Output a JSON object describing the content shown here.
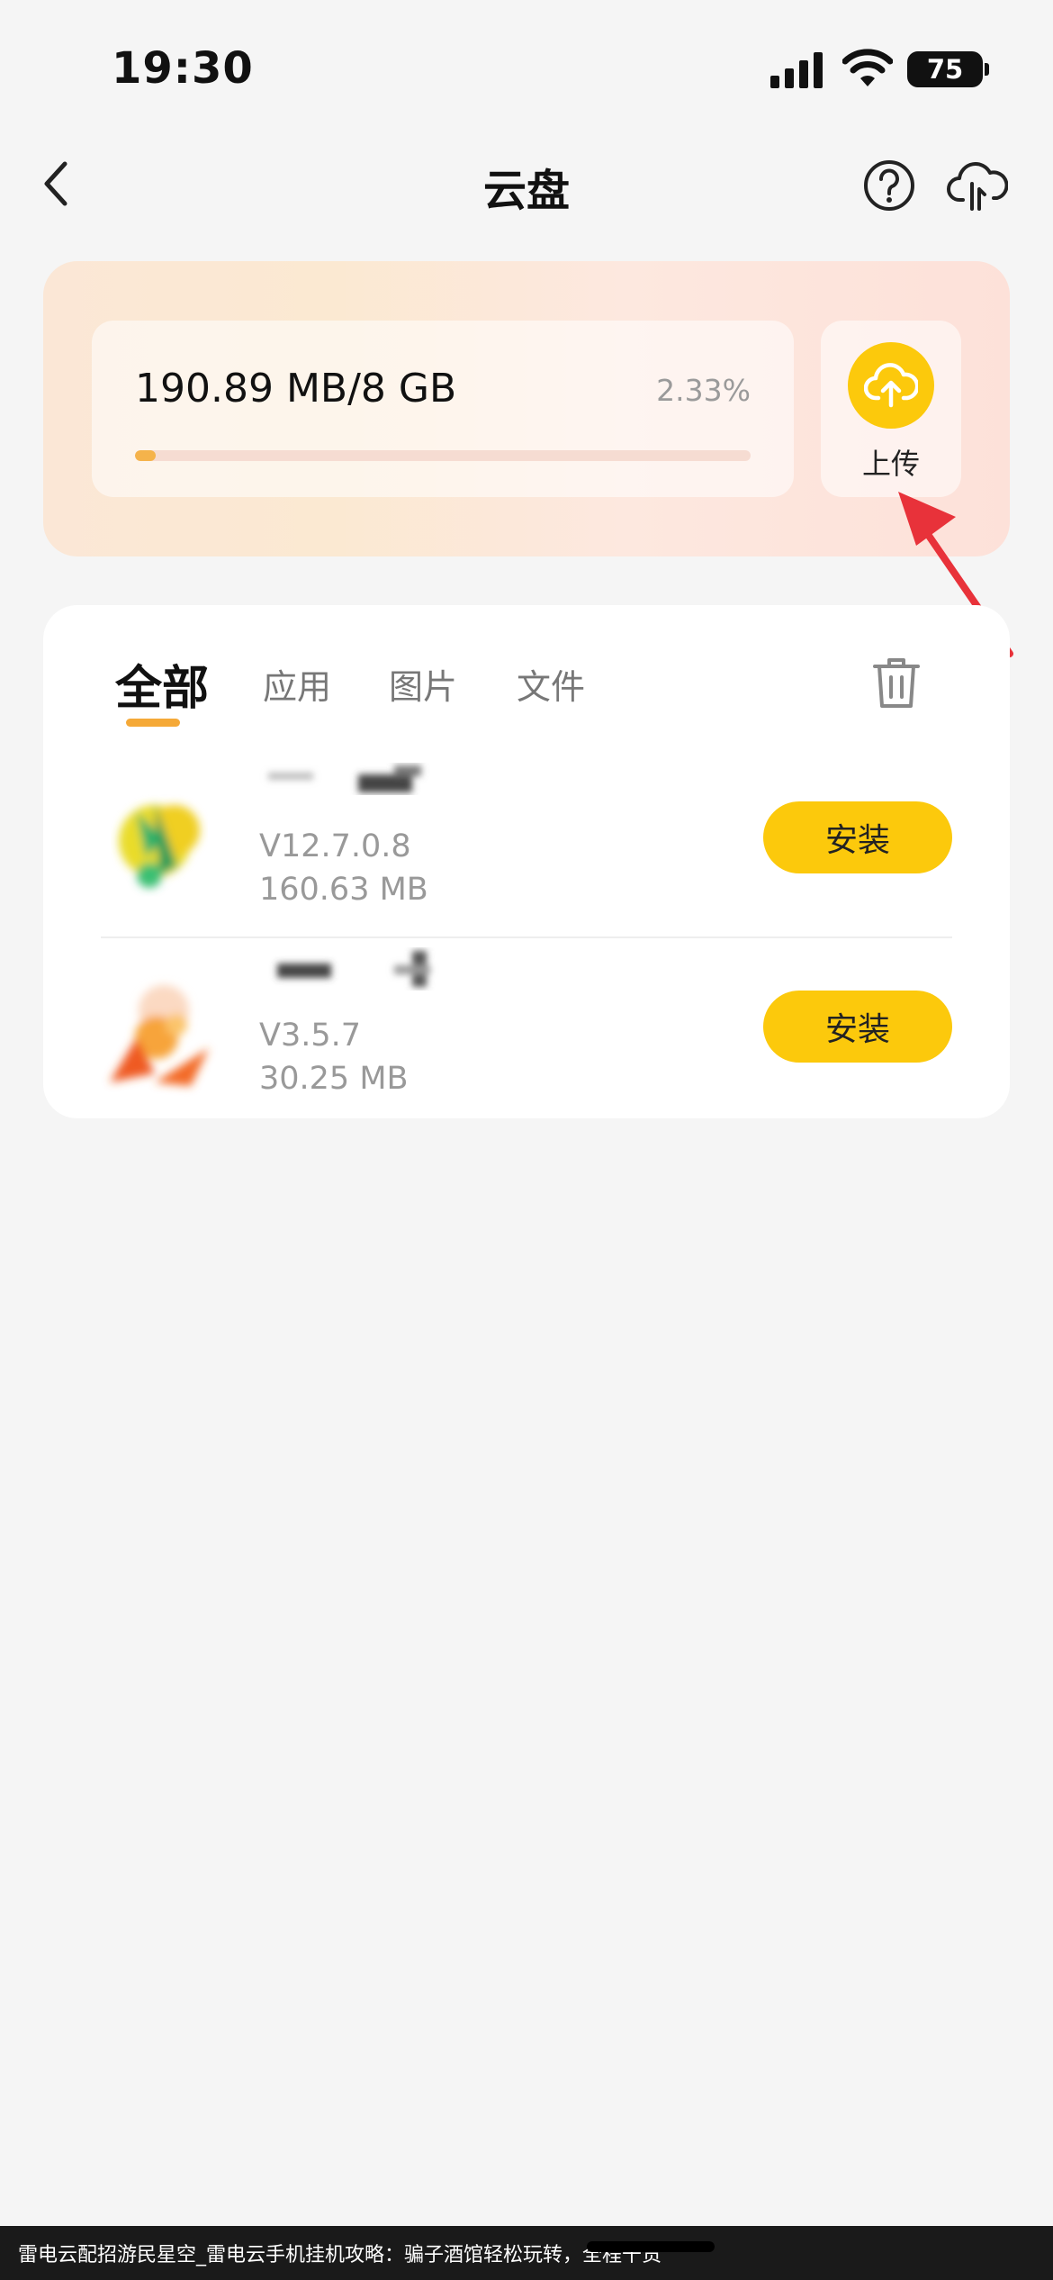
{
  "status_bar": {
    "time": "19:30",
    "battery": "75"
  },
  "header": {
    "title": "云盘"
  },
  "storage": {
    "usage": "190.89 MB/8 GB",
    "percent": "2.33%",
    "progress_fraction": 0.0233,
    "upload_label": "上传"
  },
  "tabs": [
    {
      "label": "全部",
      "active": true
    },
    {
      "label": "应用",
      "active": false
    },
    {
      "label": "图片",
      "active": false
    },
    {
      "label": "文件",
      "active": false
    }
  ],
  "files": [
    {
      "version": "V12.7.0.8",
      "size": "160.63 MB",
      "action": "安装"
    },
    {
      "version": "V3.5.7",
      "size": "30.25 MB",
      "action": "安装"
    }
  ],
  "caption": "雷电云配招游民星空_雷电云手机挂机攻略：骗子酒馆轻松玩转，全程干货",
  "colors": {
    "accent_yellow": "#fcc90c",
    "progress": "#f5b34b",
    "arrow": "#e8323a"
  }
}
